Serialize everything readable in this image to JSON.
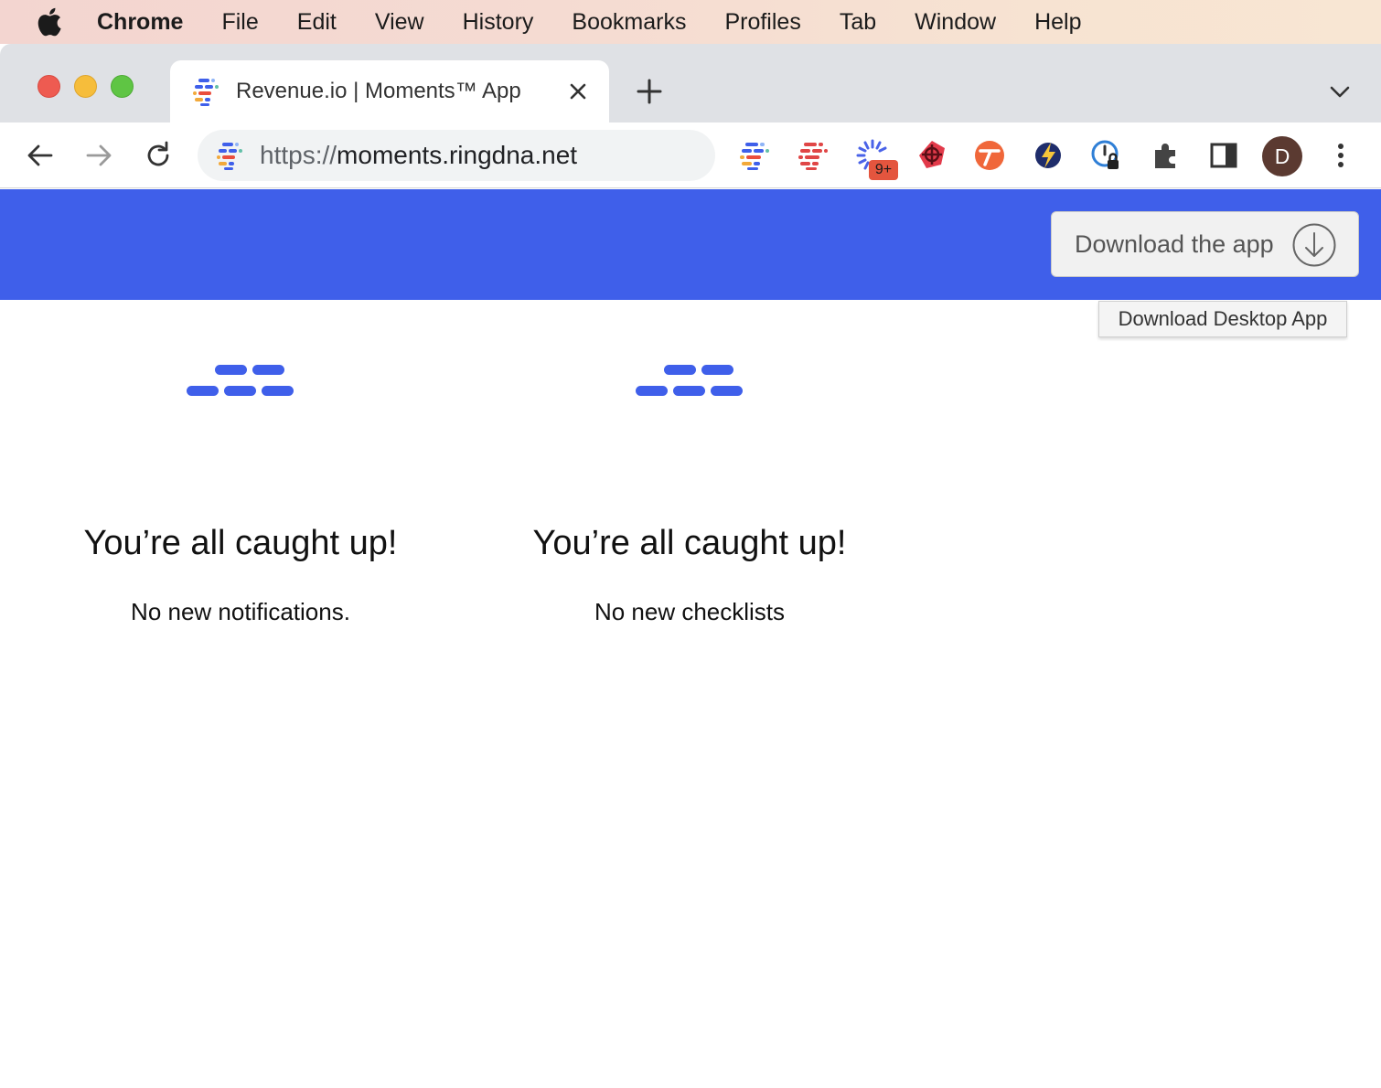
{
  "menubar": {
    "app_name": "Chrome",
    "items": [
      "File",
      "Edit",
      "View",
      "History",
      "Bookmarks",
      "Profiles",
      "Tab",
      "Window",
      "Help"
    ]
  },
  "browser": {
    "tab": {
      "title": "Revenue.io | Moments™ App"
    },
    "address": {
      "scheme": "https://",
      "host": "moments.ringdna.net"
    },
    "extensions_badge": "9+",
    "profile_initial": "D"
  },
  "page": {
    "header_color": "#3f5fea",
    "download_button_label": "Download the app",
    "tooltip": "Download Desktop App",
    "panels": [
      {
        "title": "You’re all caught up!",
        "subtitle": "No new notifications."
      },
      {
        "title": "You’re all caught up!",
        "subtitle": "No new checklists"
      }
    ]
  }
}
